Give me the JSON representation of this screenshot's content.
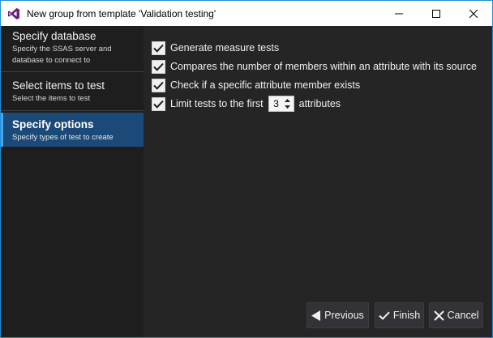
{
  "window": {
    "title": "New group from template 'Validation testing'",
    "accent_color": "#1e90d8"
  },
  "sidebar": {
    "steps": [
      {
        "title": "Specify database",
        "desc_line1": "Specify the SSAS server and",
        "desc_line2": "database to connect to",
        "active": false
      },
      {
        "title": "Select items to test",
        "desc_line1": "Select the items to test",
        "desc_line2": "",
        "active": false
      },
      {
        "title": "Specify options",
        "desc_line1": "Specify types of test to create",
        "desc_line2": "",
        "active": true
      }
    ],
    "active_color": "#1c4a78"
  },
  "options": {
    "generate_measure": {
      "label": "Generate measure tests",
      "checked": true
    },
    "compare_members": {
      "label": "Compares the number of members within an attribute with its source",
      "checked": true
    },
    "check_member": {
      "label": "Check if a specific attribute member exists",
      "checked": true
    },
    "limit_tests": {
      "label_before": "Limit tests to the first",
      "value": "3",
      "label_after": "attributes",
      "checked": true
    }
  },
  "buttons": {
    "previous": "Previous",
    "finish": "Finish",
    "cancel": "Cancel"
  }
}
